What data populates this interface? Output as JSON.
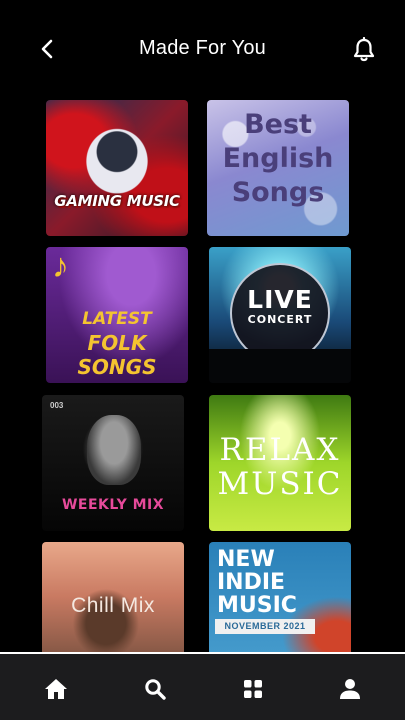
{
  "header": {
    "title": "Made For You",
    "back_icon": "chevron-left-icon",
    "notification_icon": "bell-icon"
  },
  "playlists": [
    {
      "label": "GAMING MUSIC"
    },
    {
      "label_lines": [
        "Best",
        "English",
        "Songs"
      ]
    },
    {
      "label_lines": [
        "LATEST",
        "FOLK SONGS"
      ]
    },
    {
      "label_lines": [
        "LIVE",
        "CONCERT"
      ]
    },
    {
      "badge": "003",
      "label": "WEEKLY MIX"
    },
    {
      "label_lines": [
        "RELAX",
        "MUSIC"
      ]
    },
    {
      "label": "Chill Mix"
    },
    {
      "label_lines": [
        "NEW",
        "INDIE",
        "MUSIC"
      ],
      "banner": "NOVEMBER 2021"
    }
  ],
  "bottom_nav": {
    "items": [
      {
        "icon": "home-icon",
        "active": false
      },
      {
        "icon": "search-icon",
        "active": false
      },
      {
        "icon": "grid-icon",
        "active": true
      },
      {
        "icon": "user-icon",
        "active": false
      }
    ]
  },
  "colors": {
    "background": "#000000",
    "nav_background": "#1c1c1e",
    "text": "#ffffff"
  }
}
